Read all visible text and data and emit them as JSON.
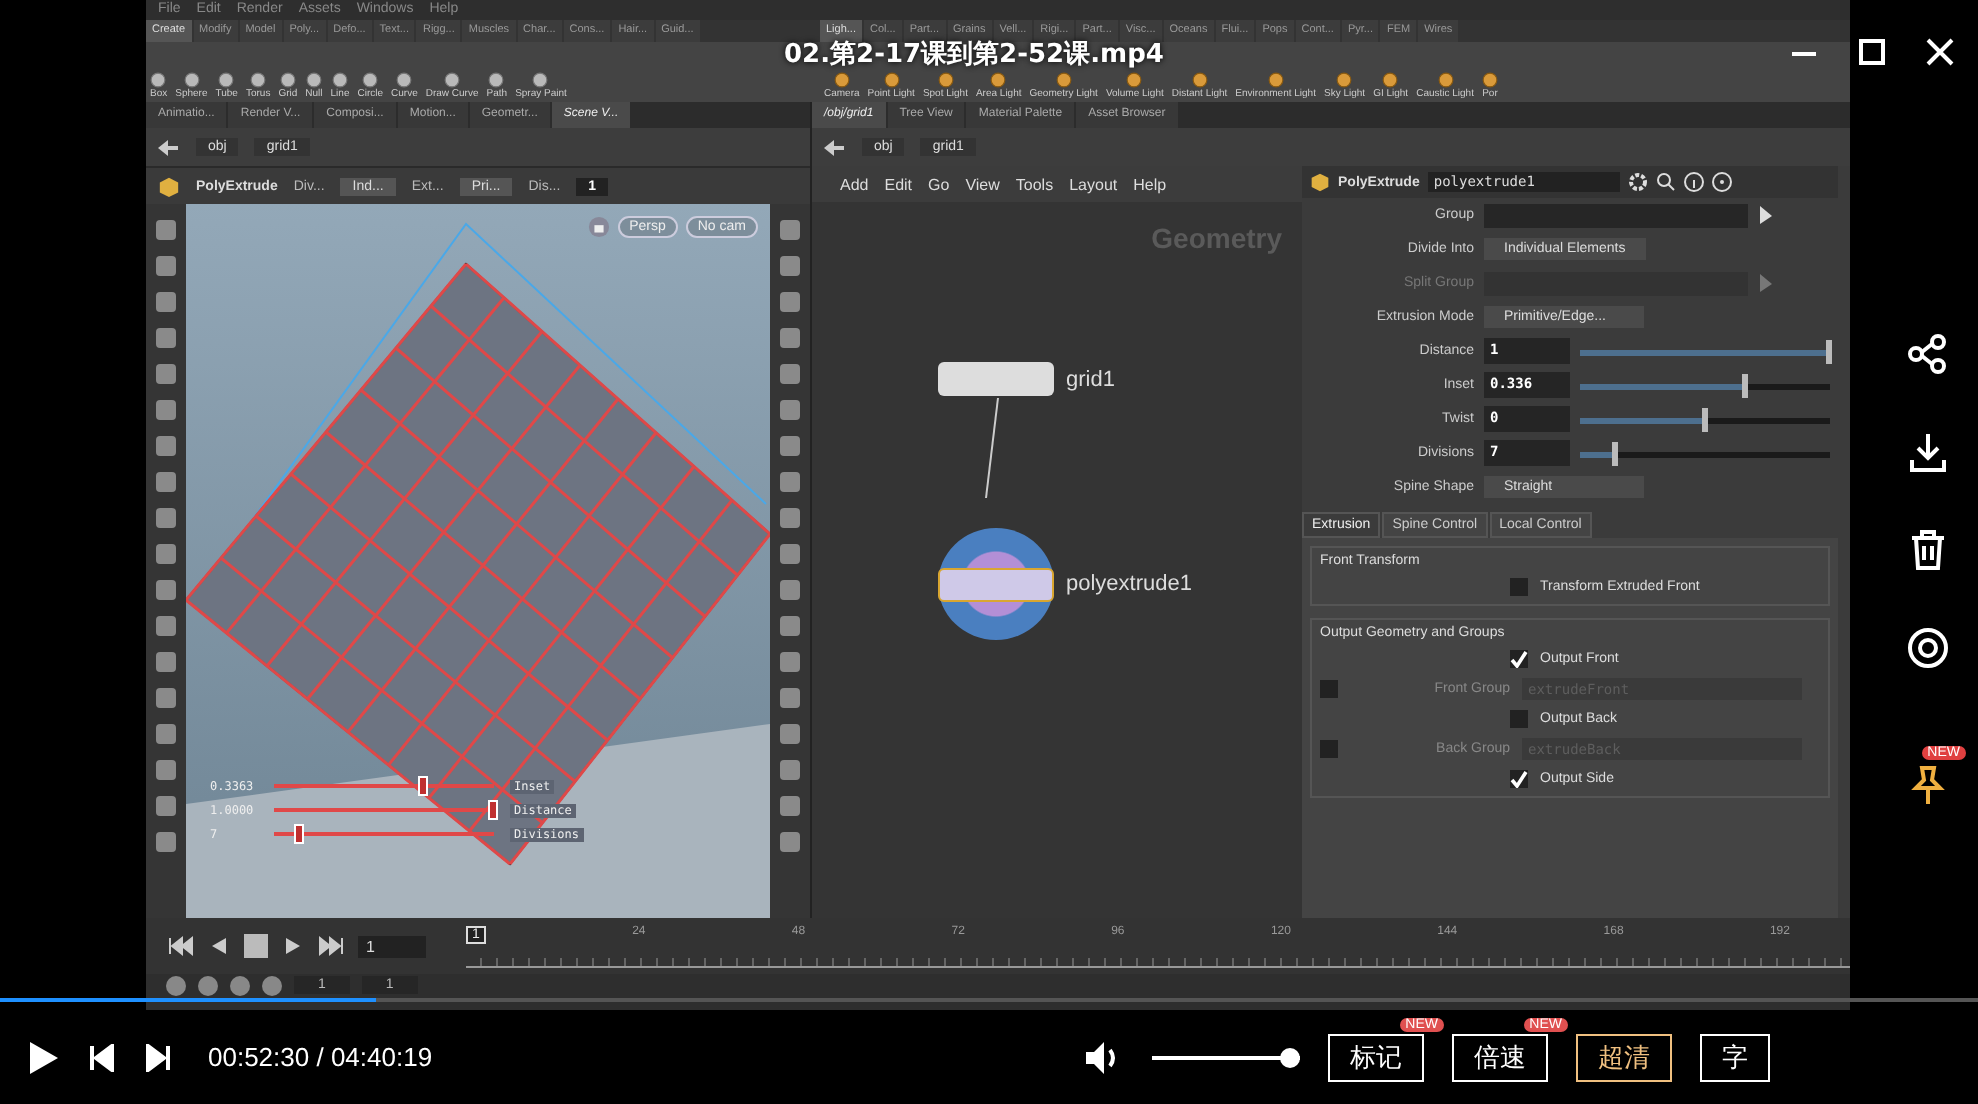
{
  "player": {
    "title": "02.第2-17课到第2-52课.mp4",
    "progress": {
      "level": 0.19
    },
    "time": "00:52:30 / 04:40:19",
    "volume": {
      "level": 1.0
    },
    "buttons": [
      {
        "label": "标记",
        "badge": "NEW",
        "selected": false
      },
      {
        "label": "倍速",
        "badge": "NEW",
        "selected": false
      },
      {
        "label": "超清",
        "selected": true
      },
      {
        "label": "字",
        "selected": false
      }
    ],
    "side_actions": [
      {
        "kind": "share"
      },
      {
        "kind": "download"
      },
      {
        "kind": "delete"
      },
      {
        "kind": "view"
      },
      {
        "kind": "pin",
        "badge": "NEW"
      }
    ]
  },
  "menu": [
    "File",
    "Edit",
    "Render",
    "Assets",
    "Windows",
    "Help"
  ],
  "shelf_tabs_left": [
    {
      "label": "Create",
      "selected": true
    },
    {
      "label": "Modify",
      "selected": false
    },
    {
      "label": "Model",
      "selected": false
    },
    {
      "label": "Poly...",
      "selected": false
    },
    {
      "label": "Defo...",
      "selected": false
    },
    {
      "label": "Text...",
      "selected": false
    },
    {
      "label": "Rigg...",
      "selected": false
    },
    {
      "label": "Muscles",
      "selected": false
    },
    {
      "label": "Char...",
      "selected": false
    },
    {
      "label": "Cons...",
      "selected": false
    },
    {
      "label": "Hair...",
      "selected": false
    },
    {
      "label": "Guid...",
      "selected": false
    }
  ],
  "shelf_tabs_right": [
    {
      "label": "Ligh...",
      "selected": true
    },
    {
      "label": "Col...",
      "selected": false
    },
    {
      "label": "Part...",
      "selected": false
    },
    {
      "label": "Grains",
      "selected": false
    },
    {
      "label": "Vell...",
      "selected": false
    },
    {
      "label": "Rigi...",
      "selected": false
    },
    {
      "label": "Part...",
      "selected": false
    },
    {
      "label": "Visc...",
      "selected": false
    },
    {
      "label": "Oceans",
      "selected": false
    },
    {
      "label": "Flui...",
      "selected": false
    },
    {
      "label": "Pops",
      "selected": false
    },
    {
      "label": "Cont...",
      "selected": false
    },
    {
      "label": "Pyr...",
      "selected": false
    },
    {
      "label": "FEM",
      "selected": false
    },
    {
      "label": "Wires",
      "selected": false
    }
  ],
  "shelf_tools_left": [
    "Box",
    "Sphere",
    "Tube",
    "Torus",
    "Grid",
    "Null",
    "Line",
    "Circle",
    "Curve",
    "Draw Curve",
    "Path",
    "Spray Paint"
  ],
  "shelf_tools_right": [
    "Camera",
    "Point Light",
    "Spot Light",
    "Area Light",
    "Geometry Light",
    "Volume Light",
    "Distant Light",
    "Environment Light",
    "Sky Light",
    "GI Light",
    "Caustic Light",
    "Por"
  ],
  "scene_tabs": [
    {
      "label": "Animatio...",
      "selected": false
    },
    {
      "label": "Render V...",
      "selected": false
    },
    {
      "label": "Composi...",
      "selected": false
    },
    {
      "label": "Motion...",
      "selected": false
    },
    {
      "label": "Geometr...",
      "selected": false
    },
    {
      "label": "Scene V...",
      "selected": true
    }
  ],
  "scene_path": [
    "obj",
    "grid1"
  ],
  "op_toolbar": {
    "title": "PolyExtrude",
    "items": [
      {
        "kind": "label",
        "text": "Div..."
      },
      {
        "kind": "menu",
        "text": "Ind..."
      },
      {
        "kind": "label",
        "text": "Ext..."
      },
      {
        "kind": "menu",
        "text": "Pri..."
      },
      {
        "kind": "label",
        "text": "Dis..."
      },
      {
        "kind": "field",
        "text": "1"
      }
    ]
  },
  "viewport": {
    "camera_menus": [
      "Persp",
      "No cam"
    ],
    "handles": [
      {
        "value": "0.3363",
        "label": "Inset",
        "level": 0.68
      },
      {
        "value": "1.0000",
        "label": "Distance",
        "level": 1.0
      },
      {
        "value": "7",
        "label": "Divisions",
        "level": 0.12
      }
    ]
  },
  "network_tabs": [
    {
      "label": "/obj/grid1",
      "selected": true
    },
    {
      "label": "Tree View",
      "selected": false
    },
    {
      "label": "Material Palette",
      "selected": false
    },
    {
      "label": "Asset Browser",
      "selected": false
    }
  ],
  "network_path": [
    "obj",
    "grid1"
  ],
  "network_menu": [
    "Add",
    "Edit",
    "Go",
    "View",
    "Tools",
    "Layout",
    "Help"
  ],
  "network": {
    "context": "Geometry",
    "nodes": [
      {
        "name": "grid1",
        "kind": "grid"
      },
      {
        "name": "polyextrude1",
        "kind": "extrude"
      }
    ]
  },
  "params": {
    "type": "PolyExtrude",
    "name": "polyextrude1",
    "rows": [
      {
        "label": "Group",
        "kind": "text",
        "disabled": false
      },
      {
        "label": "Divide Into",
        "kind": "menu",
        "value": "Individual Elements",
        "disabled": false
      },
      {
        "label": "Split Group",
        "kind": "text",
        "disabled": true
      },
      {
        "label": "Extrusion Mode",
        "kind": "menu",
        "value": "Primitive/Edge...",
        "disabled": false
      },
      {
        "label": "Distance",
        "kind": "slider",
        "value": "1",
        "level": 1.0,
        "disabled": false
      },
      {
        "label": "Inset",
        "kind": "slider",
        "value": "0.336",
        "level": 0.66,
        "disabled": false
      },
      {
        "label": "Twist",
        "kind": "slider",
        "value": "0",
        "level": 0.5,
        "disabled": false
      },
      {
        "label": "Divisions",
        "kind": "slider",
        "value": "7",
        "level": 0.14,
        "disabled": false
      },
      {
        "label": "Spine Shape",
        "kind": "menu",
        "value": "Straight",
        "disabled": false
      }
    ],
    "tabs": [
      {
        "label": "Extrusion",
        "selected": true
      },
      {
        "label": "Spine Control",
        "selected": false
      },
      {
        "label": "Local Control",
        "selected": false
      }
    ],
    "sections": [
      {
        "title": "Front Transform",
        "items": [
          {
            "kind": "toggle",
            "label": "Transform Extruded Front",
            "checked": false
          }
        ]
      },
      {
        "title": "Output Geometry and Groups",
        "items": [
          {
            "kind": "toggle",
            "label": "Output Front",
            "checked": true
          },
          {
            "kind": "group",
            "label": "Front Group",
            "placeholder": "extrudeFront",
            "checked": false
          },
          {
            "kind": "toggle",
            "label": "Output Back",
            "checked": false
          },
          {
            "kind": "group",
            "label": "Back Group",
            "placeholder": "extrudeBack",
            "checked": false
          },
          {
            "kind": "toggle",
            "label": "Output Side",
            "checked": true
          }
        ]
      }
    ]
  },
  "timeline": {
    "frame": "1",
    "current": "1",
    "ticks": [
      "24",
      "48",
      "72",
      "96",
      "120",
      "144",
      "168",
      "192"
    ],
    "range_start": "1",
    "range_end": "1"
  }
}
